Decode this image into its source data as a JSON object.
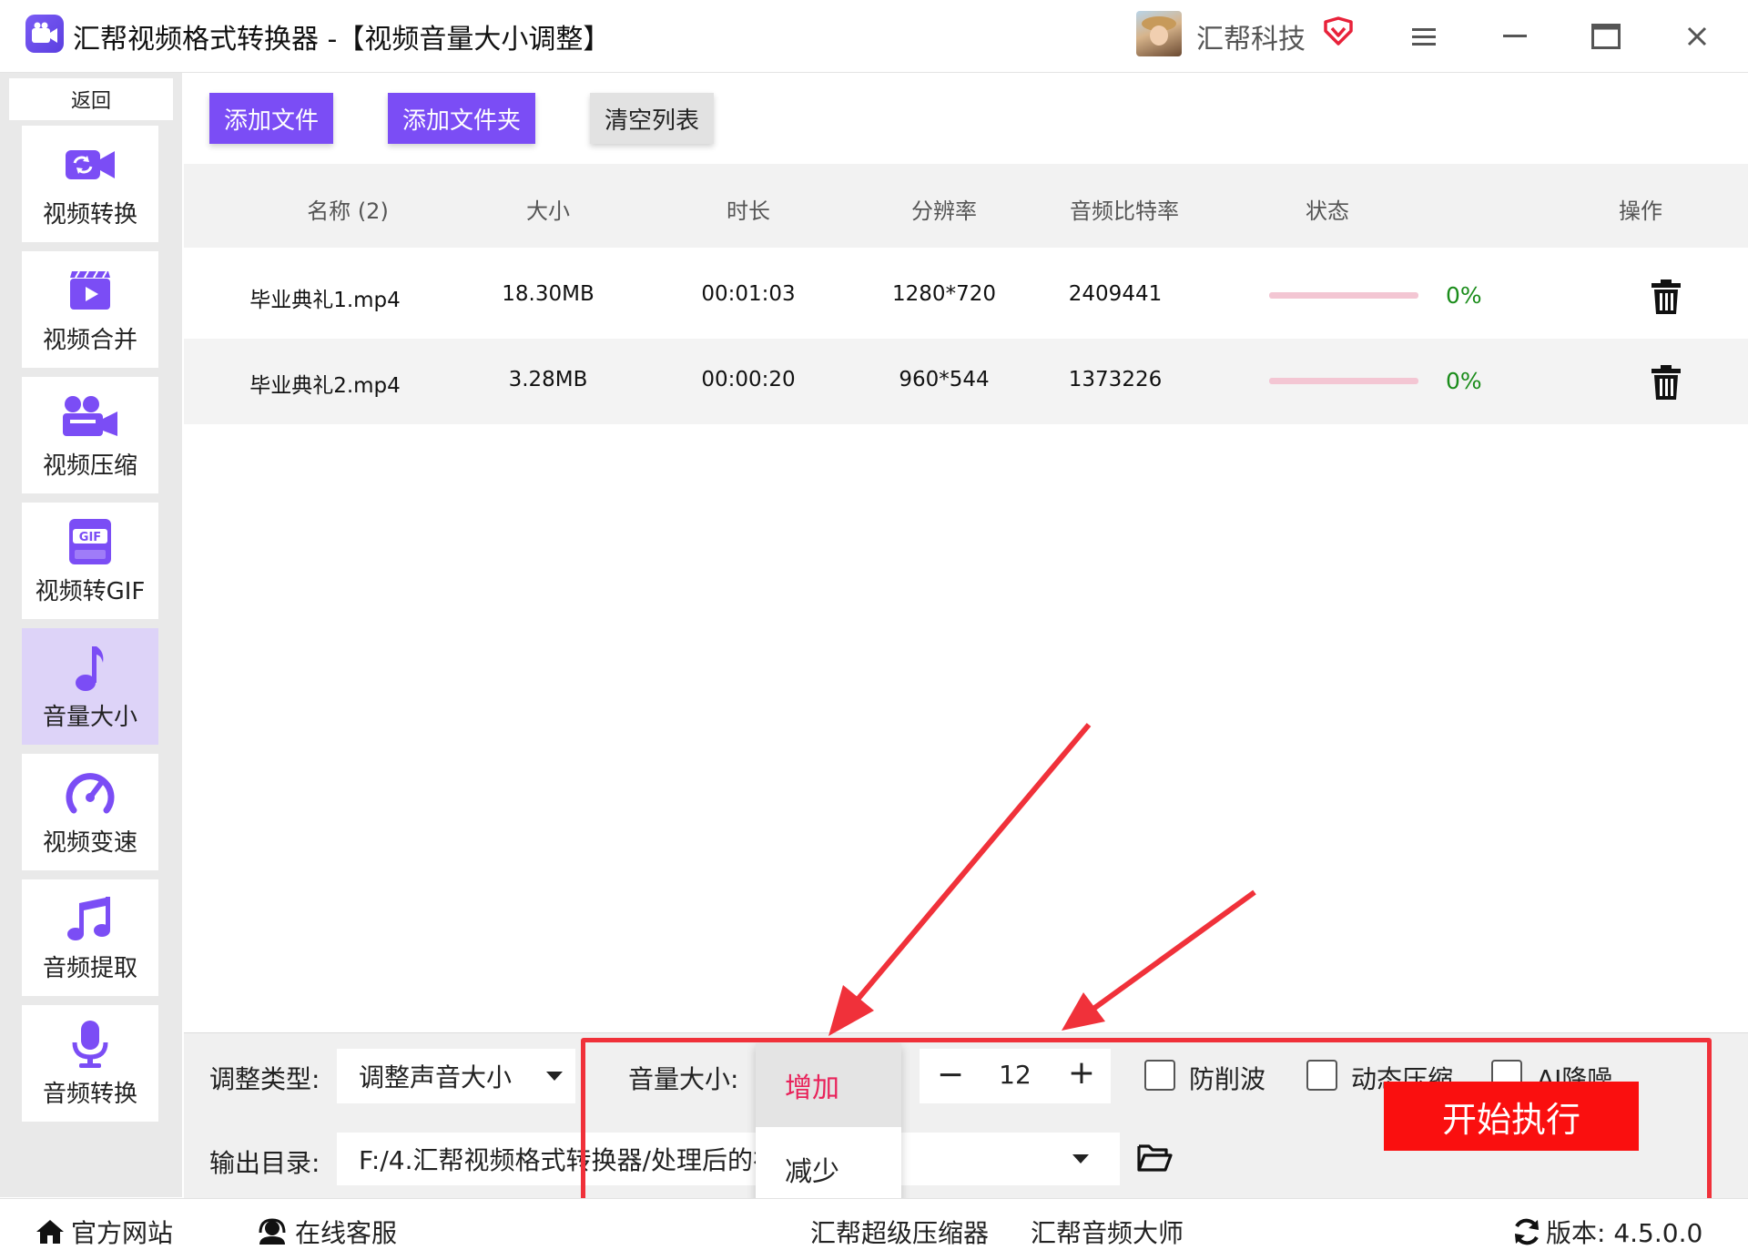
{
  "window": {
    "title": "汇帮视频格式转换器  -【视频音量大小调整】",
    "brand": "汇帮科技"
  },
  "sidebar": {
    "back": "返回",
    "items": [
      {
        "label": "视频转换",
        "icon": "video-convert-icon"
      },
      {
        "label": "视频合并",
        "icon": "video-merge-icon"
      },
      {
        "label": "视频压缩",
        "icon": "video-compress-icon"
      },
      {
        "label": "视频转GIF",
        "icon": "gif-icon"
      },
      {
        "label": "音量大小",
        "icon": "music-note-icon",
        "active": true
      },
      {
        "label": "视频变速",
        "icon": "speedometer-icon"
      },
      {
        "label": "音频提取",
        "icon": "music-notes-icon"
      },
      {
        "label": "音频转换",
        "icon": "microphone-icon"
      }
    ]
  },
  "toolbar": {
    "add_file": "添加文件",
    "add_folder": "添加文件夹",
    "clear_list": "清空列表"
  },
  "table": {
    "headers": [
      "名称 (2)",
      "大小",
      "时长",
      "分辨率",
      "音频比特率",
      "状态",
      "操作"
    ],
    "rows": [
      {
        "name": "毕业典礼1.mp4",
        "size": "18.30MB",
        "duration": "00:01:03",
        "resolution": "1280*720",
        "bitrate": "2409441",
        "progress": 0,
        "progress_text": "0%"
      },
      {
        "name": "毕业典礼2.mp4",
        "size": "3.28MB",
        "duration": "00:00:20",
        "resolution": "960*544",
        "bitrate": "1373226",
        "progress": 0,
        "progress_text": "0%"
      }
    ]
  },
  "settings": {
    "adjust_type_label": "调整类型:",
    "adjust_type_value": "调整声音大小",
    "volume_label": "音量大小:",
    "volume_options": [
      "增加",
      "减少"
    ],
    "volume_selected": "增加",
    "volume_value": "12",
    "minus": "−",
    "plus": "+",
    "anti_clip": "防削波",
    "dynamic_compress": "动态压缩",
    "ai_denoise": "AI降噪",
    "output_label": "输出目录:",
    "output_path": "F:/4.汇帮视频格式转换器/处理后的视频",
    "start": "开始执行"
  },
  "statusbar": {
    "website": "官方网站",
    "service": "在线客服",
    "link1": "汇帮超级压缩器",
    "link2": "汇帮音频大师",
    "version": "版本: 4.5.0.0"
  },
  "colors": {
    "accent": "#7b4df5",
    "active_nav": "#ddd3f8",
    "start_button": "#fa0f0f",
    "annotation": "#f0313a",
    "progress_ok": "#1a8c1a"
  }
}
